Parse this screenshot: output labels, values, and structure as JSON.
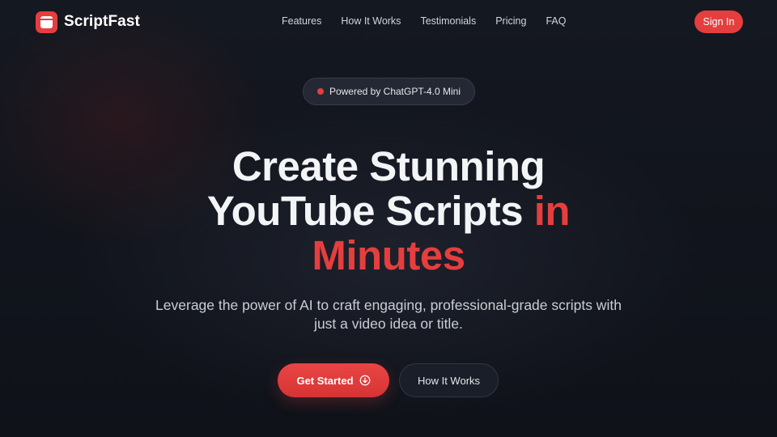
{
  "brand": {
    "name": "ScriptFast",
    "logo_icon": "browser-window-icon",
    "accent_color": "#e53e3e"
  },
  "nav": {
    "links": [
      "Features",
      "How It Works",
      "Testimonials",
      "Pricing",
      "FAQ"
    ],
    "sign_in_label": "Sign In"
  },
  "hero": {
    "badge_text": "Powered by ChatGPT-4.0 Mini",
    "headline_line1": "Create Stunning",
    "headline_line2_main": "YouTube Scripts",
    "headline_line2_accent": "in",
    "headline_line3_accent": "Minutes",
    "subheadline": "Leverage the power of AI to craft engaging, professional-grade scripts with just a video idea or title.",
    "primary_cta_label": "Get Started",
    "primary_cta_icon": "arrow-down-circle-icon",
    "secondary_cta_label": "How It Works"
  },
  "colors": {
    "background": "#12151d",
    "accent": "#e53e3e",
    "text_primary": "#f3f4f6",
    "text_secondary": "#c9cdd4"
  }
}
